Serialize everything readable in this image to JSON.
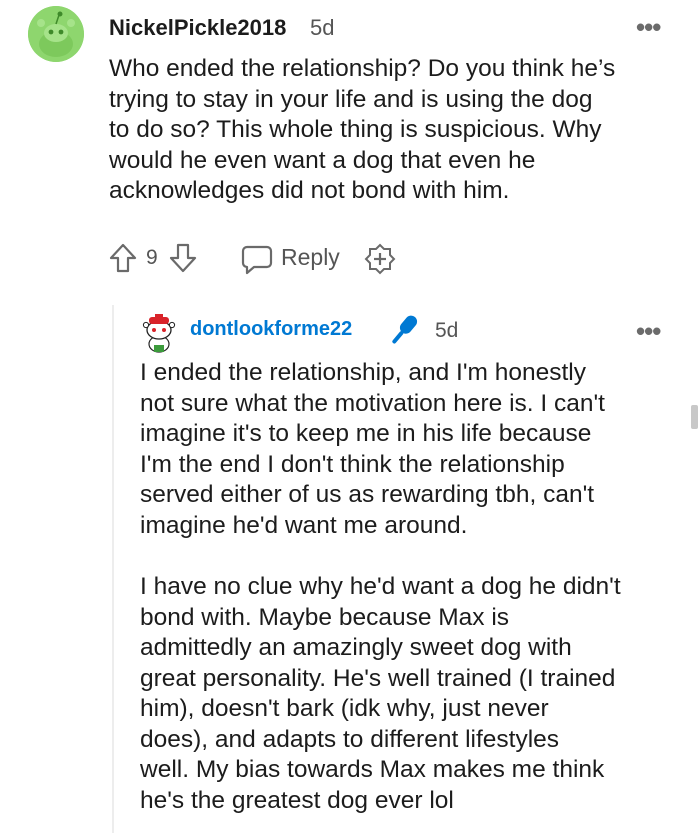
{
  "comment": {
    "author": "NickelPickle2018",
    "age": "5d",
    "more_label": "•••",
    "text": "Who ended the relationship? Do you think he’s\ntrying to stay in your life and is using the dog\nto do so? This whole thing is suspicious. Why\nwould he even want a dog that even he\nacknowledges did not bond with him.",
    "votes": "9",
    "reply_label": "Reply"
  },
  "reply": {
    "author": "dontlookforme22",
    "age": "5d",
    "more_label": "•••",
    "paragraph1": "I ended the relationship, and I'm honestly\nnot sure what the motivation here is. I can't\nimagine it's to keep me in his life because\nI'm the end I don't think the relationship\nserved either of us as rewarding tbh, can't\nimagine he'd want me around.",
    "paragraph2": "I have no clue why he'd want a dog he didn't\nbond with. Maybe because Max is\nadmittedly an amazingly sweet dog with\ngreat personality. He's well trained (I trained\nhim), doesn't bark (idk why, just never\ndoes), and adapts to different lifestyles\nwell. My bias towards Max makes me think\nhe's the greatest dog ever lol"
  },
  "colors": {
    "avatar_green": "#8ed66e",
    "op_blue": "#0079d3",
    "text": "#1c1c1c",
    "meta": "#555555"
  },
  "icons": [
    "snoo-avatar-icon",
    "upvote-icon",
    "downvote-icon",
    "reply-icon",
    "award-icon",
    "op-microphone-icon",
    "more-options-icon"
  ]
}
